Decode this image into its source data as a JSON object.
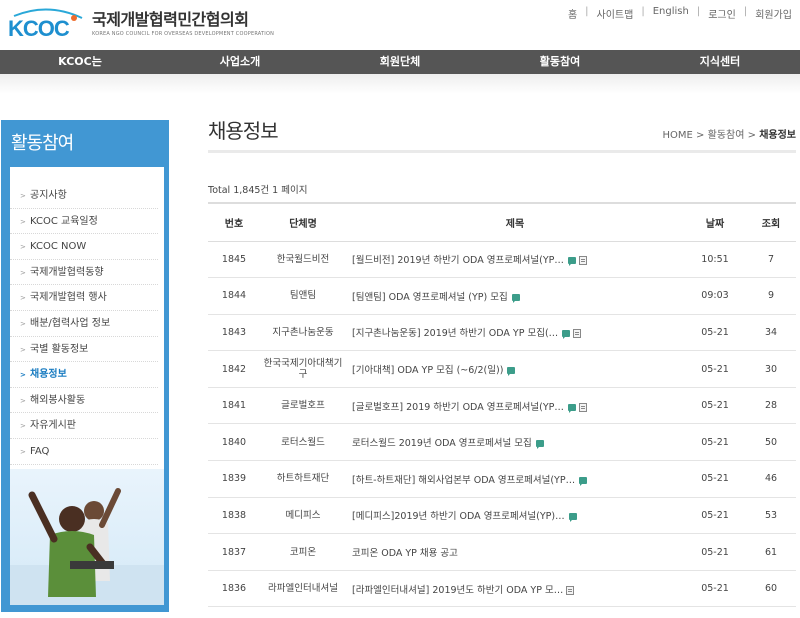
{
  "brand": {
    "logo_text": "KCOC",
    "name_ko": "국제개발협력민간협의회",
    "name_en": "KOREA NGO COUNCIL FOR OVERSEAS DEVELOPMENT COOPERATION",
    "colors": {
      "primary": "#4197d3",
      "nav": "#555555",
      "accent": "#1a7cc1"
    }
  },
  "util_links": [
    "홈",
    "사이트맵",
    "English",
    "로그인",
    "회원가입"
  ],
  "gnb": [
    "KCOC는",
    "사업소개",
    "회원단체",
    "활동참여",
    "지식센터"
  ],
  "sidebar": {
    "title": "활동참여",
    "items": [
      "공지사항",
      "KCOC 교육일정",
      "KCOC NOW",
      "국제개발협력동향",
      "국제개발협력 행사",
      "배분/협력사업 정보",
      "국별 활동정보",
      "채용정보",
      "해외봉사활동",
      "자유게시판",
      "FAQ"
    ],
    "active_index": 7
  },
  "page": {
    "title": "채용정보",
    "breadcrumb": [
      "HOME",
      "활동참여",
      "채용정보"
    ],
    "total": "Total 1,845건 1 페이지"
  },
  "table": {
    "headers": [
      "번호",
      "단체명",
      "제목",
      "날짜",
      "조회"
    ],
    "rows": [
      {
        "num": "1845",
        "org": "한국월드비전",
        "subject": "[월드비전] 2019년 하반기 ODA 영프로페셔널(YP…",
        "comment": true,
        "file": true,
        "date": "10:51",
        "hits": "7"
      },
      {
        "num": "1844",
        "org": "팀앤팀",
        "subject": "[팀앤팀] ODA 영프로페셔널 (YP) 모집",
        "comment": true,
        "file": false,
        "date": "09:03",
        "hits": "9"
      },
      {
        "num": "1843",
        "org": "지구촌나눔운동",
        "subject": "[지구촌나눔운동] 2019년 하반기 ODA YP 모집(…",
        "comment": true,
        "file": true,
        "date": "05-21",
        "hits": "34"
      },
      {
        "num": "1842",
        "org": "한국국제기아대책기구",
        "subject": "[기아대책] ODA YP 모집 (~6/2(일))",
        "comment": true,
        "file": false,
        "date": "05-21",
        "hits": "30"
      },
      {
        "num": "1841",
        "org": "글로벌호프",
        "subject": "[글로벌호프] 2019 하반기 ODA 영프로페셔널(YP…",
        "comment": true,
        "file": true,
        "date": "05-21",
        "hits": "28"
      },
      {
        "num": "1840",
        "org": "로터스월드",
        "subject": "로터스월드 2019년 ODA 영프로페셔널 모집",
        "comment": true,
        "file": false,
        "date": "05-21",
        "hits": "50"
      },
      {
        "num": "1839",
        "org": "하트하트재단",
        "subject": "[하트-하트재단] 해외사업본부 ODA 영프로페셔널(YP…",
        "comment": true,
        "file": false,
        "date": "05-21",
        "hits": "46"
      },
      {
        "num": "1838",
        "org": "메디피스",
        "subject": "[메디피스]2019년 하반기 ODA 영프로페셔널(YP)…",
        "comment": true,
        "file": false,
        "date": "05-21",
        "hits": "53"
      },
      {
        "num": "1837",
        "org": "코피온",
        "subject": "코피온 ODA YP 채용 공고",
        "comment": false,
        "file": false,
        "date": "05-21",
        "hits": "61"
      },
      {
        "num": "1836",
        "org": "라파엘인터내셔널",
        "subject": "[라파엘인터내셔널] 2019년도 하반기 ODA YP 모…",
        "comment": false,
        "file": true,
        "date": "05-21",
        "hits": "60"
      }
    ]
  }
}
